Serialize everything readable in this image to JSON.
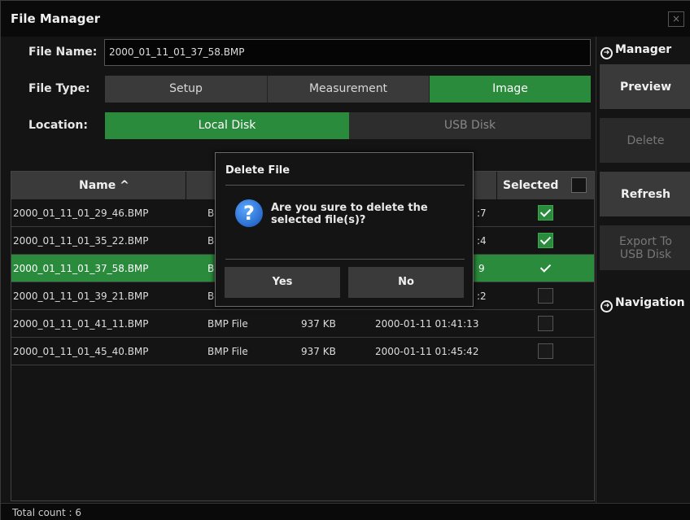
{
  "window": {
    "title": "File Manager",
    "close_label": "×"
  },
  "form": {
    "file_name_label": "File Name:",
    "file_name_value": "2000_01_11_01_37_58.BMP",
    "file_type_label": "File Type:",
    "file_types": [
      {
        "label": "Setup",
        "active": false
      },
      {
        "label": "Measurement",
        "active": false
      },
      {
        "label": "Image",
        "active": true
      }
    ],
    "location_label": "Location:",
    "locations": [
      {
        "label": "Local Disk",
        "active": true
      },
      {
        "label": "USB Disk",
        "active": false
      }
    ]
  },
  "table": {
    "columns": [
      "Name ^",
      "",
      "",
      "",
      "Selected"
    ],
    "rows": [
      {
        "name": "2000_01_11_01_29_46.BMP",
        "type": "B",
        "size": "",
        "date": ":7",
        "checked": true,
        "selected": false
      },
      {
        "name": "2000_01_11_01_35_22.BMP",
        "type": "B",
        "size": "",
        "date": ":4",
        "checked": true,
        "selected": false
      },
      {
        "name": "2000_01_11_01_37_58.BMP",
        "type": "B",
        "size": "",
        "date": "9",
        "checked": true,
        "selected": true
      },
      {
        "name": "2000_01_11_01_39_21.BMP",
        "type": "B",
        "size": "",
        "date": ":2",
        "checked": false,
        "selected": false
      },
      {
        "name": "2000_01_11_01_41_11.BMP",
        "type": "BMP File",
        "size": "937 KB",
        "date": "2000-01-11 01:41:13",
        "checked": false,
        "selected": false
      },
      {
        "name": "2000_01_11_01_45_40.BMP",
        "type": "BMP File",
        "size": "937 KB",
        "date": "2000-01-11 01:45:42",
        "checked": false,
        "selected": false
      }
    ]
  },
  "status": {
    "text": "Total count :  6"
  },
  "sidebar": {
    "manager_heading": "Manager",
    "navigation_heading": "Navigation",
    "buttons": {
      "preview": "Preview",
      "delete": "Delete",
      "refresh": "Refresh",
      "export": "Export To USB Disk"
    },
    "icons": {
      "heading": "circle-arrow-right-icon"
    }
  },
  "dialog": {
    "title": "Delete File",
    "message": "Are you sure to delete the selected file(s)?",
    "icon": "question-icon",
    "yes_label": "Yes",
    "no_label": "No"
  },
  "colors": {
    "accent": "#2a8b3d",
    "button": "#3a3a3a",
    "background": "#141414",
    "question": "#1e6fd6"
  }
}
